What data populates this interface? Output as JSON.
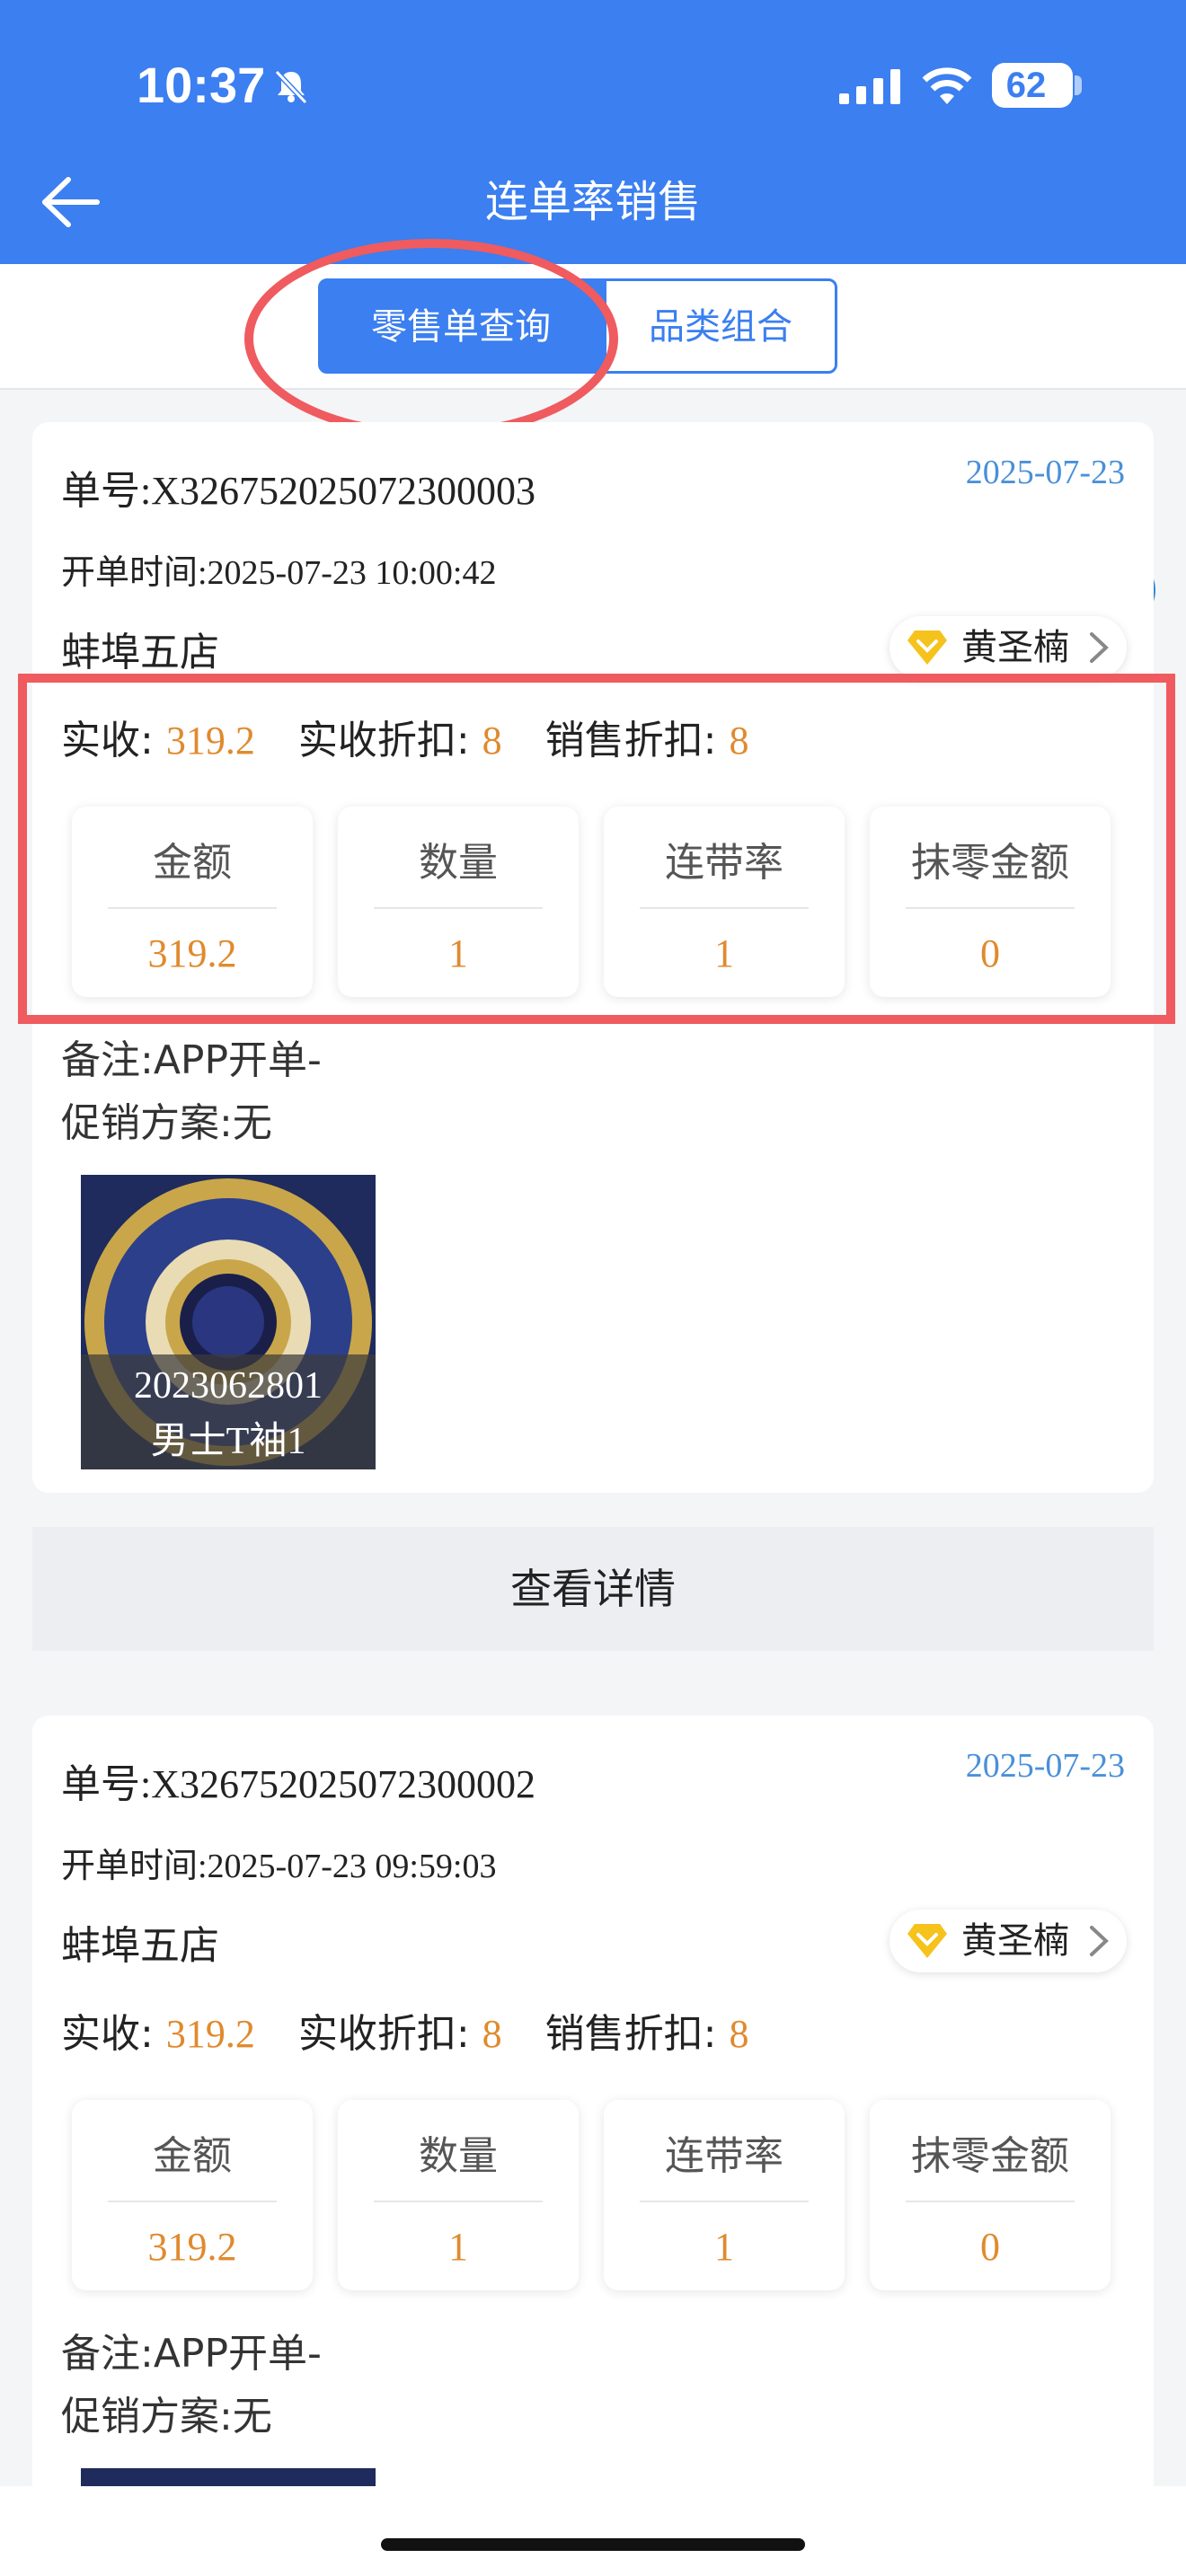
{
  "status_bar": {
    "time": "10:37",
    "battery": "62"
  },
  "header": {
    "title": "连单率销售"
  },
  "tabs": [
    {
      "label": "零售单查询",
      "active": true
    },
    {
      "label": "品类组合",
      "active": false
    }
  ],
  "orders": [
    {
      "order_no": "单号:X326752025072300003",
      "date": "2025-07-23",
      "open_time": "开单时间:2025-07-23 10:00:42",
      "store": "蚌埠五店",
      "staff": "黄圣楠",
      "summary": [
        {
          "label": "实收:",
          "value": "319.2"
        },
        {
          "label": "实收折扣:",
          "value": "8"
        },
        {
          "label": "销售折扣:",
          "value": "8"
        }
      ],
      "stats": [
        {
          "label": "金额",
          "value": "319.2"
        },
        {
          "label": "数量",
          "value": "1"
        },
        {
          "label": "连带率",
          "value": "1"
        },
        {
          "label": "抹零金额",
          "value": "0"
        }
      ],
      "remark": "备注:APP开单-",
      "promotion": "促销方案:无",
      "product": {
        "code": "2023062801",
        "name": "男士T袖1"
      }
    },
    {
      "order_no": "单号:X326752025072300002",
      "date": "2025-07-23",
      "open_time": "开单时间:2025-07-23 09:59:03",
      "store": "蚌埠五店",
      "staff": "黄圣楠",
      "summary": [
        {
          "label": "实收:",
          "value": "319.2"
        },
        {
          "label": "实收折扣:",
          "value": "8"
        },
        {
          "label": "销售折扣:",
          "value": "8"
        }
      ],
      "stats": [
        {
          "label": "金额",
          "value": "319.2"
        },
        {
          "label": "数量",
          "value": "1"
        },
        {
          "label": "连带率",
          "value": "1"
        },
        {
          "label": "抹零金额",
          "value": "0"
        }
      ],
      "remark": "备注:APP开单-",
      "promotion": "促销方案:无"
    }
  ],
  "detail_button": "查看详情",
  "colors": {
    "primary": "#3b7ff0",
    "accent": "#e08a2e",
    "date": "#4a90d9",
    "annotation": "#ef5b5f"
  }
}
